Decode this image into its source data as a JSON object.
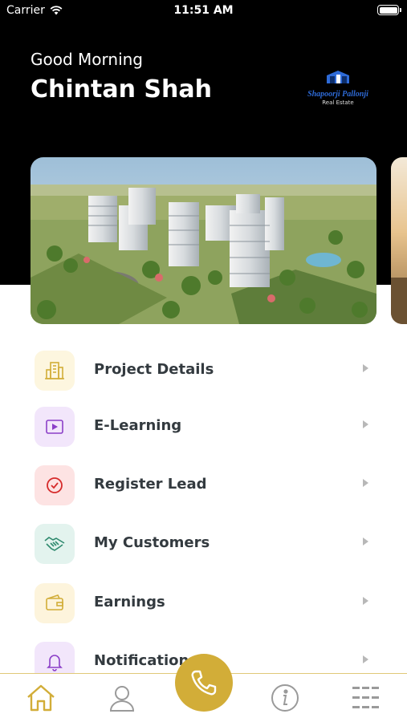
{
  "status_bar": {
    "carrier": "Carrier",
    "time": "11:51 AM",
    "battery_level": 1.0
  },
  "header": {
    "greeting": "Good Morning",
    "user_name": "Chintan Shah",
    "logo": {
      "brand": "Shapoorji Pallonji",
      "tagline": "Real Estate"
    }
  },
  "banner": {
    "image": "residential-towers-aerial-illustration"
  },
  "menu": {
    "items": [
      {
        "label": "Project Details",
        "icon": "building-icon",
        "bg": "#fdf6df",
        "color": "#d2ad38"
      },
      {
        "label": "E-Learning",
        "icon": "play-video-icon",
        "bg": "#f2e6fb",
        "color": "#8b3fc8"
      },
      {
        "label": "Register Lead",
        "icon": "check-circle-icon",
        "bg": "#fde3e3",
        "color": "#d62b2b"
      },
      {
        "label": "My Customers",
        "icon": "handshake-icon",
        "bg": "#e3f3ee",
        "color": "#2f8a6e"
      },
      {
        "label": "Earnings",
        "icon": "wallet-icon",
        "bg": "#fdf4dc",
        "color": "#d2ad38"
      },
      {
        "label": "Notifications",
        "icon": "bell-icon",
        "bg": "#f2e6fb",
        "color": "#8b3fc8"
      }
    ]
  },
  "tab_bar": {
    "tabs": [
      "home-icon",
      "profile-icon",
      "phone-icon",
      "info-icon",
      "menu-grid-icon"
    ],
    "accent": "#d2ad38",
    "inactive": "#9a9a9a"
  }
}
